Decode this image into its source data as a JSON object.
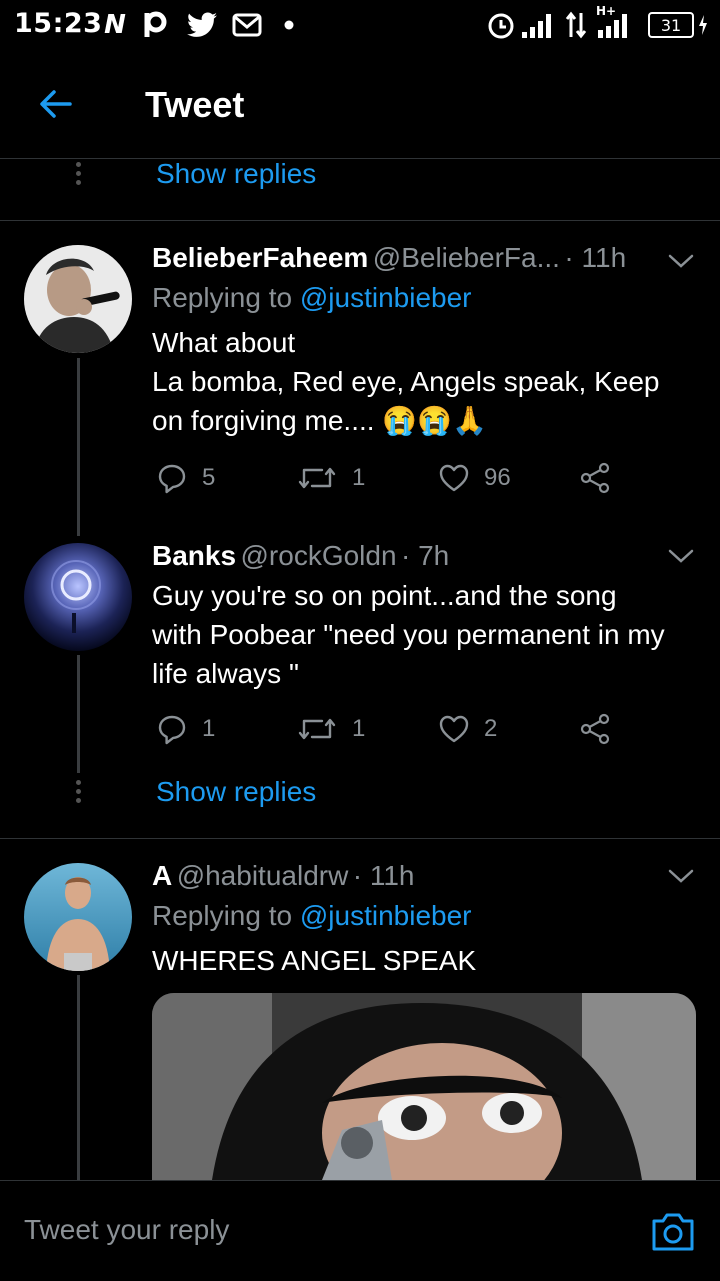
{
  "status_bar": {
    "time": "15:23",
    "battery": "31",
    "network_label": "H+"
  },
  "header": {
    "title": "Tweet"
  },
  "top_show_replies": "Show replies",
  "tweets": [
    {
      "name": "BelieberFaheem",
      "handle": "@BelieberFa...",
      "time": "· 11h",
      "replying_prefix": "Replying to ",
      "replying_to": "@justinbieber",
      "text_lines": [
        "What about",
        "La bomba, Red eye, Angels speak, Keep",
        "on forgiving me.... 😭😭🙏"
      ],
      "replies": "5",
      "retweets": "1",
      "likes": "96"
    },
    {
      "name": "Banks",
      "handle": "@rockGoldn",
      "time": "· 7h",
      "text_lines": [
        "Guy you're so on point...and the song",
        "with Poobear \"need you permanent in my",
        "life always \""
      ],
      "replies": "1",
      "retweets": "1",
      "likes": "2",
      "show_replies": "Show replies"
    },
    {
      "name": "A",
      "handle": "@habitualdrw",
      "time": "· 11h",
      "replying_prefix": "Replying to ",
      "replying_to": "@justinbieber",
      "text_lines": [
        "WHERES ANGEL SPEAK"
      ]
    }
  ],
  "reply_bar": {
    "placeholder": "Tweet your reply"
  },
  "colors": {
    "accent": "#1d9bf0",
    "muted": "#8b9196",
    "border": "#2f3336"
  }
}
